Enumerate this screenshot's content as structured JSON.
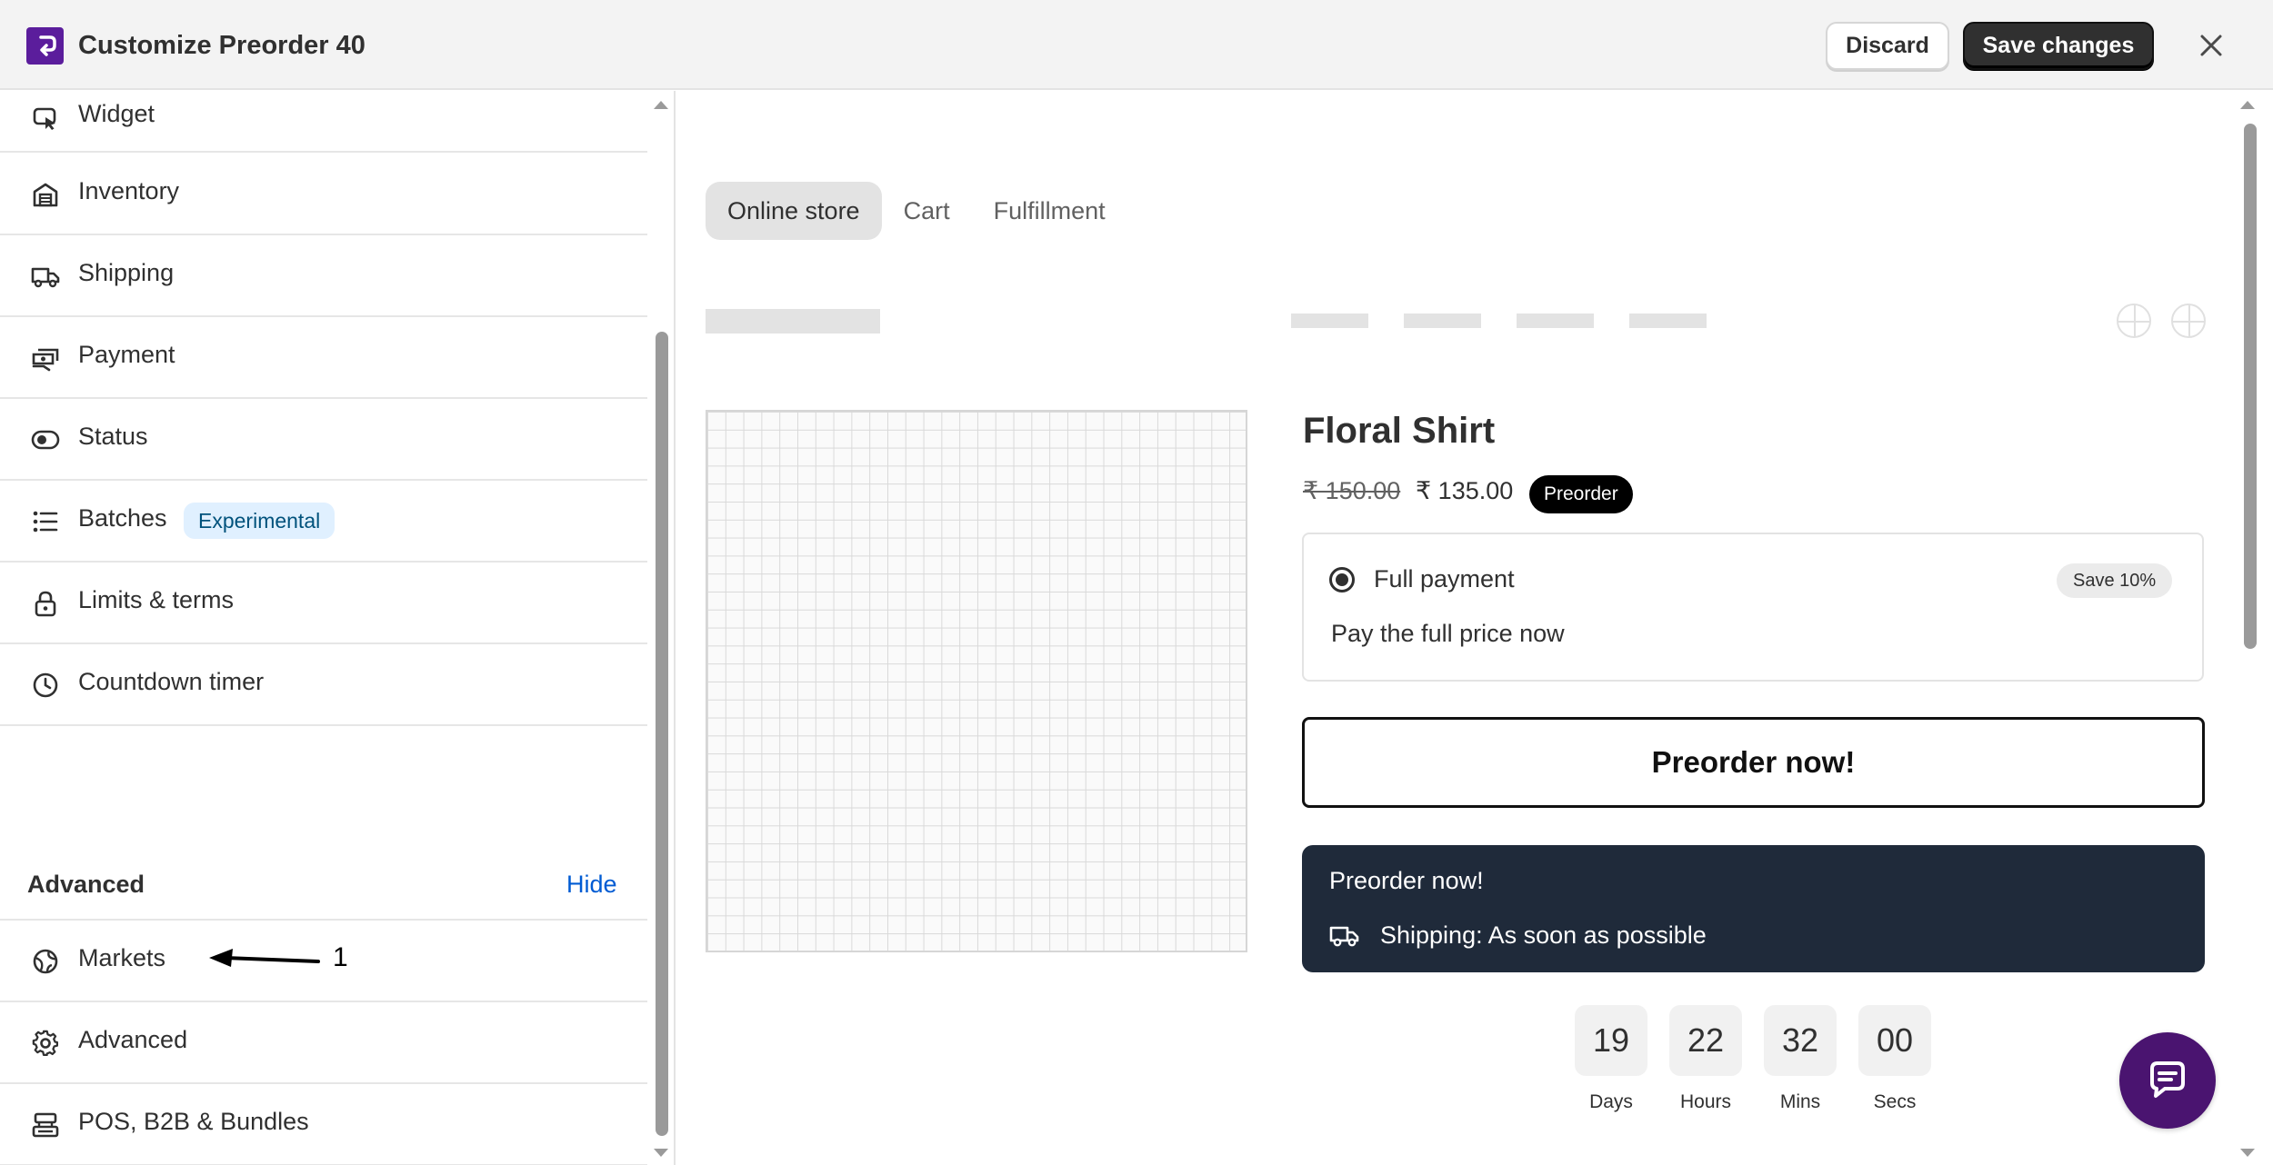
{
  "header": {
    "title": "Customize Preorder 40",
    "discard_label": "Discard",
    "save_label": "Save changes"
  },
  "sidebar": {
    "items": [
      {
        "label": "Widget",
        "icon": "cursor-icon"
      },
      {
        "label": "Inventory",
        "icon": "warehouse-icon"
      },
      {
        "label": "Shipping",
        "icon": "truck-icon"
      },
      {
        "label": "Payment",
        "icon": "cash-icon"
      },
      {
        "label": "Status",
        "icon": "toggle-icon"
      },
      {
        "label": "Batches",
        "icon": "list-icon",
        "badge": "Experimental"
      },
      {
        "label": "Limits & terms",
        "icon": "lock-icon"
      },
      {
        "label": "Countdown timer",
        "icon": "clock-icon"
      }
    ],
    "advanced_section": {
      "title": "Advanced",
      "toggle_label": "Hide",
      "items": [
        {
          "label": "Markets",
          "icon": "globe-icon"
        },
        {
          "label": "Advanced",
          "icon": "gear-icon"
        },
        {
          "label": "POS, B2B & Bundles",
          "icon": "pos-icon"
        }
      ]
    },
    "annotation_number": "1"
  },
  "preview": {
    "tabs": [
      {
        "label": "Online store",
        "active": true
      },
      {
        "label": "Cart",
        "active": false
      },
      {
        "label": "Fulfillment",
        "active": false
      }
    ],
    "product": {
      "title": "Floral Shirt",
      "price_original": "₹ 150.00",
      "price_sale": "₹ 135.00",
      "badge": "Preorder"
    },
    "payment_option": {
      "label": "Full payment",
      "badge": "Save 10%",
      "description": "Pay the full price now"
    },
    "preorder_button": "Preorder now!",
    "info_card": {
      "title": "Preorder now!",
      "shipping": "Shipping: As soon as possible"
    },
    "countdown": [
      {
        "value": "19",
        "unit": "Days"
      },
      {
        "value": "22",
        "unit": "Hours"
      },
      {
        "value": "32",
        "unit": "Mins"
      },
      {
        "value": "00",
        "unit": "Secs"
      }
    ]
  },
  "colors": {
    "brand": "#5b1d9c",
    "primary_button": "#303030",
    "link": "#005bd3",
    "info_card_bg": "#1f2a3a",
    "chat_button": "#4a1470",
    "badge_experimental_bg": "#e0f0ff"
  }
}
